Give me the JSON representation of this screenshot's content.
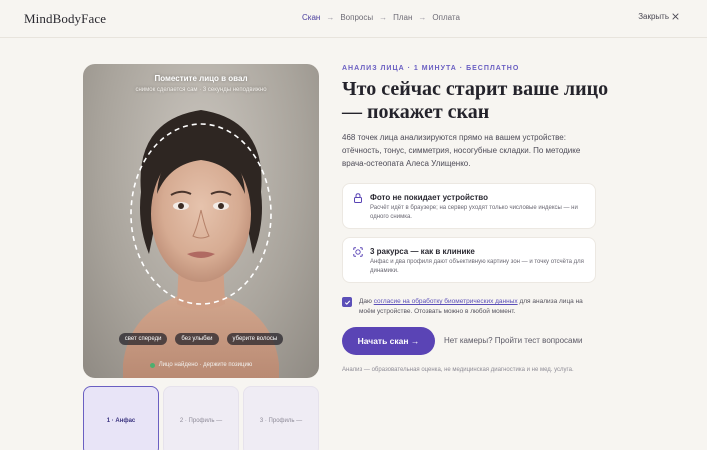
{
  "header": {
    "logo": "MindBodyFace",
    "steps": [
      {
        "label": "Скан",
        "active": true
      },
      {
        "label": "Вопросы",
        "active": false
      },
      {
        "label": "План",
        "active": false
      },
      {
        "label": "Оплата",
        "active": false
      }
    ],
    "step_arrow": "→",
    "close_label": "Закрыть"
  },
  "camera": {
    "title": "Поместите лицо в овал",
    "subtitle": "снимок сделается сам · 3 секунды неподвижно",
    "chips": [
      "свет спереди",
      "без улыбки",
      "уберите волосы"
    ],
    "status": "Лицо найдено · держите позицию",
    "status_color": "#4caf6e"
  },
  "thumbs": [
    {
      "label": "1 · Анфас",
      "active": true
    },
    {
      "label": "2 · Профиль —",
      "active": false
    },
    {
      "label": "3 · Профиль —",
      "active": false
    }
  ],
  "main": {
    "eyebrow": "АНАЛИЗ ЛИЦА · 1 МИНУТА · БЕСПЛАТНО",
    "headline": "Что сейчас старит ваше лицо — покажет скан",
    "lead": "468 точек лица анализируются прямо на вашем устройстве: отёчность, тонус, симметрия, носогубные складки. По методике врача-остеопата Алеса Улищенко.",
    "features": [
      {
        "icon": "lock-icon",
        "title": "Фото не покидает устройство",
        "desc": "Расчёт идёт в браузере; на сервер уходят только числовые индексы — ни одного снимка."
      },
      {
        "icon": "face-scan-icon",
        "title": "3 ракурса — как в клинике",
        "desc": "Анфас и два профиля дают объективную картину зон — и точку отсчёта для динамики."
      }
    ],
    "consent": {
      "checked": true,
      "before": "Даю ",
      "link": "согласие на обработку биометрических данных",
      "after": " для анализа лица на моём устройстве. Отозвать можно в любой момент."
    },
    "cta_label": "Начать скан →",
    "alt_link": "Нет камеры? Пройти тест вопросами",
    "disclaimer": "Анализ — образовательная оценка, не медицинская диагностика и не мед. услуга."
  },
  "colors": {
    "accent": "#5a44b5",
    "background": "#f7f5f1"
  }
}
